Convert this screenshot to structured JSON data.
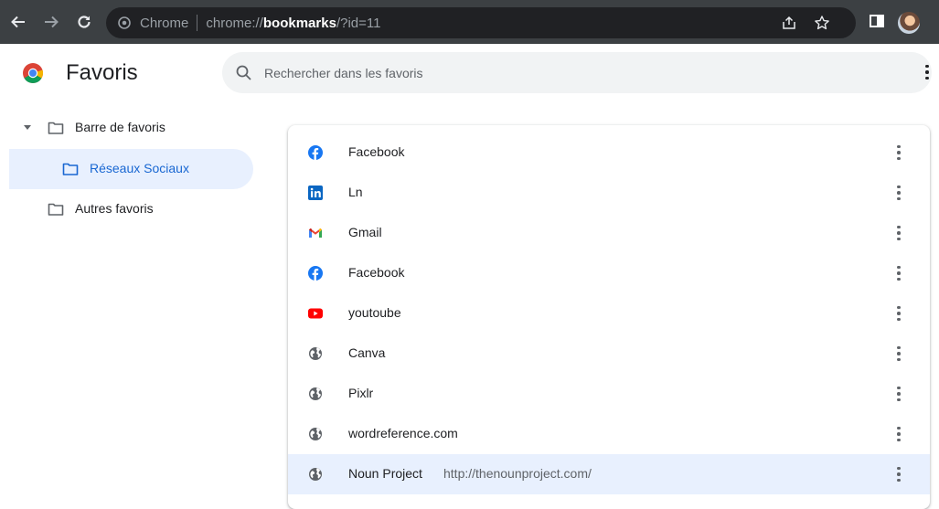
{
  "browser": {
    "chip": "Chrome",
    "url_scheme": "chrome://",
    "url_host": "bookmarks",
    "url_path": "/?id=11"
  },
  "page": {
    "title": "Favoris",
    "search_placeholder": "Rechercher dans les favoris"
  },
  "sidebar": {
    "items": [
      {
        "label": "Barre de favoris",
        "expanded": true
      },
      {
        "label": "Réseaux Sociaux",
        "selected": true
      },
      {
        "label": "Autres favoris"
      }
    ]
  },
  "bookmarks": [
    {
      "title": "Facebook",
      "icon": "facebook-icon",
      "url": ""
    },
    {
      "title": "Ln",
      "icon": "linkedin-icon",
      "url": ""
    },
    {
      "title": "Gmail",
      "icon": "gmail-icon",
      "url": ""
    },
    {
      "title": "Facebook",
      "icon": "facebook-icon",
      "url": ""
    },
    {
      "title": "youtoube",
      "icon": "youtube-icon",
      "url": ""
    },
    {
      "title": "Canva",
      "icon": "globe-icon",
      "url": ""
    },
    {
      "title": "Pixlr",
      "icon": "globe-icon",
      "url": ""
    },
    {
      "title": "wordreference.com",
      "icon": "globe-icon",
      "url": ""
    },
    {
      "title": "Noun Project",
      "icon": "globe-icon",
      "url": "http://thenounproject.com/",
      "selected": true
    }
  ],
  "colors": {
    "toolbar": "#3c4043",
    "accent": "#1967d2",
    "selection": "#e8f0fe",
    "facebook": "#1877f2",
    "linkedin": "#0a66c2",
    "youtube": "#ff0000"
  }
}
